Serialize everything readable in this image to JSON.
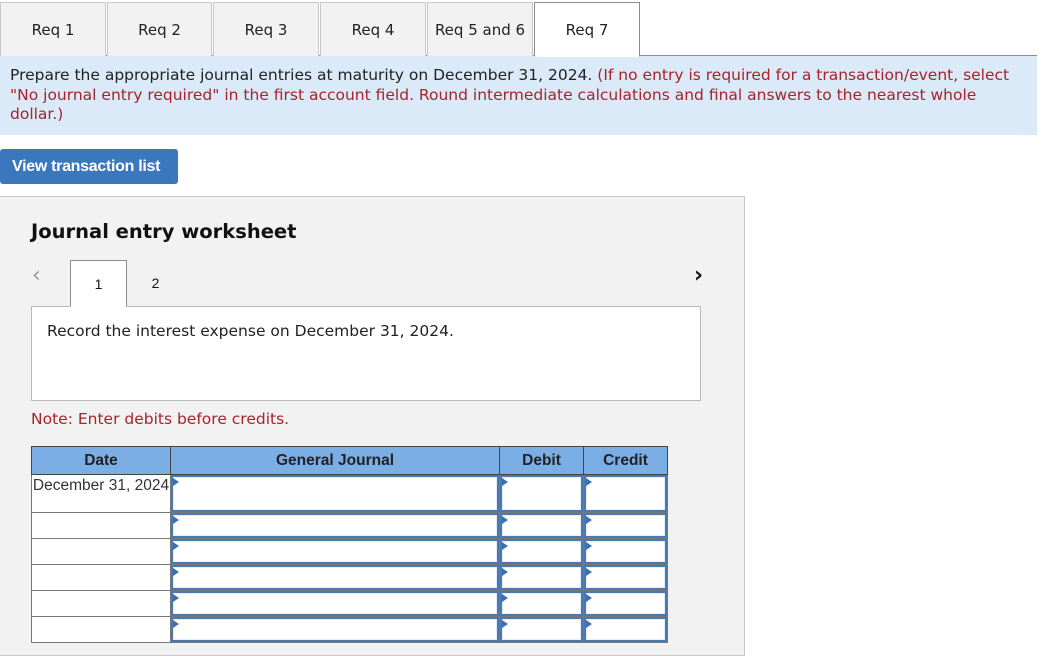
{
  "tabs": [
    {
      "label": "Req 1",
      "active": false
    },
    {
      "label": "Req 2",
      "active": false
    },
    {
      "label": "Req 3",
      "active": false
    },
    {
      "label": "Req 4",
      "active": false
    },
    {
      "label": "Req 5 and 6",
      "active": false
    },
    {
      "label": "Req 7",
      "active": true
    }
  ],
  "instructions": {
    "main": "Prepare the appropriate journal entries at maturity on December 31, 2024.",
    "note": "(If no entry is required for a transaction/event, select \"No journal entry required\" in the first account field. Round intermediate calculations and final answers to the nearest whole dollar.)"
  },
  "view_transaction_button": "View transaction list",
  "worksheet": {
    "title": "Journal entry worksheet",
    "prev_icon": "chevron-left-icon",
    "next_icon": "chevron-right-icon",
    "pages": [
      {
        "label": "1",
        "active": true
      },
      {
        "label": "2",
        "active": false
      }
    ],
    "description": "Record the interest expense on December 31, 2024.",
    "note": "Note: Enter debits before credits.",
    "table": {
      "headers": [
        "Date",
        "General Journal",
        "Debit",
        "Credit"
      ],
      "rows": [
        {
          "date": "December 31, 2024",
          "account": "",
          "debit": "",
          "credit": ""
        },
        {
          "date": "",
          "account": "",
          "debit": "",
          "credit": ""
        },
        {
          "date": "",
          "account": "",
          "debit": "",
          "credit": ""
        },
        {
          "date": "",
          "account": "",
          "debit": "",
          "credit": ""
        },
        {
          "date": "",
          "account": "",
          "debit": "",
          "credit": ""
        },
        {
          "date": "",
          "account": "",
          "debit": "",
          "credit": ""
        }
      ]
    }
  },
  "colors": {
    "banner_bg": "#daeaf8",
    "instruction_red": "#a8232a",
    "button_blue": "#3a77bc",
    "table_header_blue": "#7aaee4",
    "input_border_blue": "#4a78b0"
  }
}
